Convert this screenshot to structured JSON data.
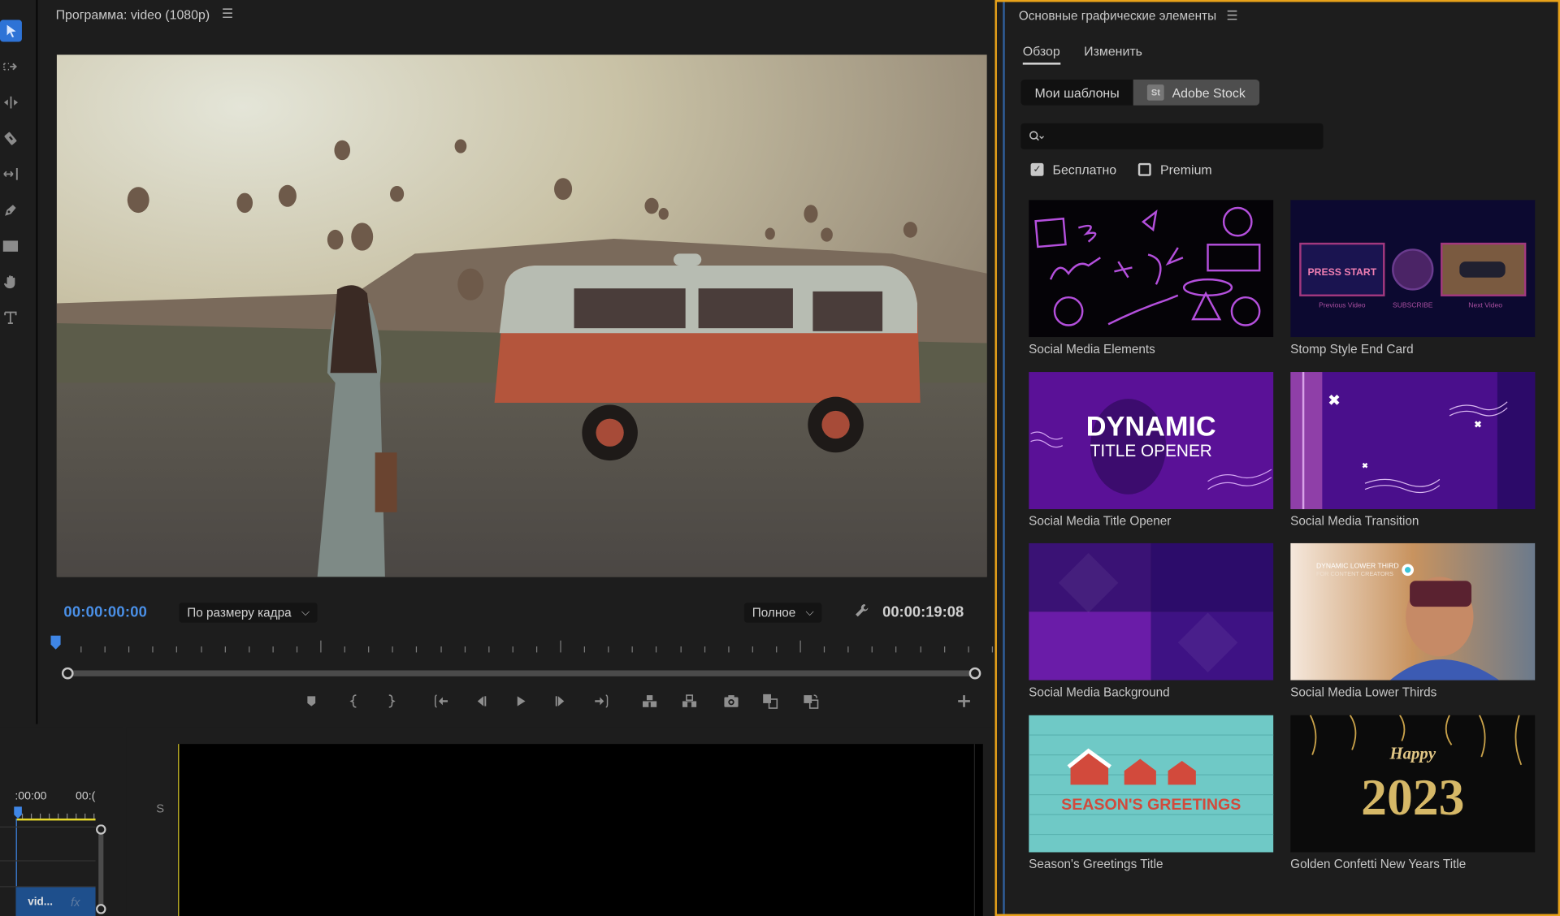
{
  "program_monitor": {
    "title": "Программа: video (1080p)",
    "menu_icon": "hamburger-icon",
    "current_timecode": "00:00:00:00",
    "fit_dropdown": "По размеру кадра",
    "quality_dropdown": "Полное",
    "total_timecode": "00:00:19:08",
    "video_description": "Woman walking toward orange-and-white vintage van with hot air balloons at sunrise",
    "transport_buttons": [
      {
        "name": "add-marker",
        "icon": "marker-icon"
      },
      {
        "name": "mark-in",
        "icon": "mark-in-icon"
      },
      {
        "name": "mark-out",
        "icon": "mark-out-icon"
      },
      {
        "name": "go-to-in",
        "icon": "go-to-in-icon"
      },
      {
        "name": "step-back",
        "icon": "step-back-icon"
      },
      {
        "name": "play",
        "icon": "play-icon"
      },
      {
        "name": "step-forward",
        "icon": "step-forward-icon"
      },
      {
        "name": "go-to-out",
        "icon": "go-to-out-icon"
      },
      {
        "name": "lift",
        "icon": "lift-icon"
      },
      {
        "name": "extract",
        "icon": "extract-icon"
      },
      {
        "name": "export-frame",
        "icon": "camera-icon"
      },
      {
        "name": "comparison-view",
        "icon": "comparison-view-icon"
      },
      {
        "name": "proxy-toggle",
        "icon": "proxy-icon"
      },
      {
        "name": "button-editor",
        "icon": "plus-icon"
      }
    ]
  },
  "tools": [
    {
      "name": "selection-tool",
      "icon": "selection-arrow-icon",
      "active": true
    },
    {
      "name": "track-select-tool",
      "icon": "track-select-icon",
      "active": false
    },
    {
      "name": "ripple-edit-tool",
      "icon": "ripple-edit-icon",
      "active": false
    },
    {
      "name": "razor-tool",
      "icon": "razor-icon",
      "active": false
    },
    {
      "name": "slip-tool",
      "icon": "slip-icon",
      "active": false
    },
    {
      "name": "pen-tool",
      "icon": "pen-icon",
      "active": false
    },
    {
      "name": "rectangle-tool",
      "icon": "rectangle-icon",
      "active": false
    },
    {
      "name": "hand-tool",
      "icon": "hand-icon",
      "active": false
    },
    {
      "name": "type-tool",
      "icon": "type-icon",
      "active": false
    }
  ],
  "mini_timeline": {
    "timecode_left": ":00:00",
    "timecode_right": "00:(",
    "clip_label": "vid...",
    "clip_fx": "fx",
    "track_label": "S"
  },
  "essential_graphics": {
    "title": "Основные графические элементы",
    "tabs": [
      {
        "label": "Обзор",
        "active": true
      },
      {
        "label": "Изменить",
        "active": false
      }
    ],
    "source_buttons": {
      "my_templates": "Мои шаблоны",
      "adobe_stock": "Adobe Stock",
      "stock_badge": "St",
      "selected": "Adobe Stock"
    },
    "search": {
      "value": "",
      "placeholder": ""
    },
    "filters": [
      {
        "label": "Бесплатно",
        "checked": true
      },
      {
        "label": "Premium",
        "checked": false
      }
    ],
    "templates": [
      {
        "title": "Social Media Elements",
        "thumb_text": ""
      },
      {
        "title": "Stomp Style End Card",
        "thumb_text": "PRESS START · Previous Video · SUBSCRIBE · Next Video"
      },
      {
        "title": "Social Media Title Opener",
        "thumb_text": "DYNAMIC TITLE OPENER"
      },
      {
        "title": "Social Media Transition",
        "thumb_text": ""
      },
      {
        "title": "Social Media Background",
        "thumb_text": ""
      },
      {
        "title": "Social Media Lower Thirds",
        "thumb_text": "DYNAMIC LOWER THIRD FOR CONTENT CREATORS"
      },
      {
        "title": "Season's Greetings Title",
        "thumb_text": "SEASON'S GREETINGS"
      },
      {
        "title": "Golden Confetti New Years Title",
        "thumb_text": "Happy 2023"
      }
    ],
    "thumb_texts": {
      "press_start": "PRESS START",
      "prev_video": "Previous Video",
      "subscribe": "SUBSCRIBE",
      "next_video": "Next Video",
      "dynamic": "DYNAMIC",
      "title_opener": "TITLE OPENER",
      "lower_third_1": "DYNAMIC LOWER THIRD",
      "lower_third_2": "FOR CONTENT CREATORS",
      "seasons": "SEASON'S GREETINGS",
      "happy": "Happy",
      "year": "2023"
    }
  },
  "colors": {
    "accent_blue": "#2e73d6",
    "timecode_blue": "#4a90e8",
    "panel_focus_border": "#e8a21a",
    "panel_bg": "#1d1d1d"
  }
}
